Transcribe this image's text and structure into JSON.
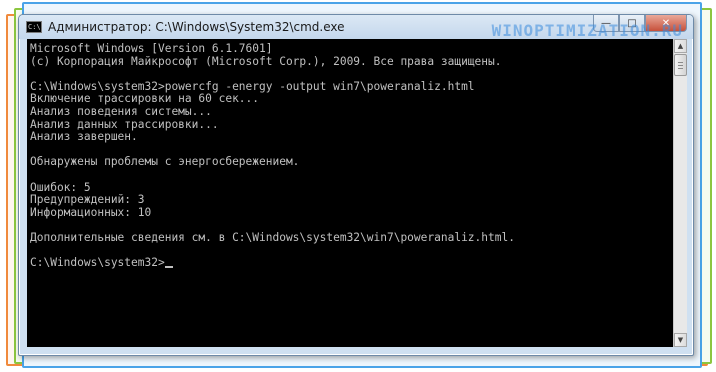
{
  "window": {
    "title": "Администратор: C:\\Windows\\System32\\cmd.exe",
    "icon": "console-icon",
    "icon_glyph": "C:\\",
    "buttons": {
      "minimize": "—",
      "maximize": "□",
      "close": "✕"
    }
  },
  "watermark": {
    "text": "WINOPTIMIZATION.RU"
  },
  "console": {
    "lines": [
      "Microsoft Windows [Version 6.1.7601]",
      "(c) Корпорация Майкрософт (Microsoft Corp.), 2009. Все права защищены.",
      "",
      "C:\\Windows\\system32>powercfg -energy -output win7\\poweranaliz.html",
      "Включение трассировки на 60 сек...",
      "Анализ поведения системы...",
      "Анализ данных трассировки...",
      "Анализ завершен.",
      "",
      "Обнаружены проблемы с энергосбережением.",
      "",
      "Ошибок: 5",
      "Предупреждений: 3",
      "Информационных: 10",
      "",
      "Дополнительные сведения см. в C:\\Windows\\system32\\win7\\poweranaliz.html.",
      "",
      "C:\\Windows\\system32>"
    ],
    "colors": {
      "background": "#000000",
      "text": "#c0c0c0"
    }
  },
  "scrollbar": {
    "up_arrow": "▲",
    "down_arrow": "▼"
  },
  "frame_colors": {
    "orange": "#f08a3c",
    "green": "#8cc63f",
    "blue": "#4aa3e8"
  }
}
